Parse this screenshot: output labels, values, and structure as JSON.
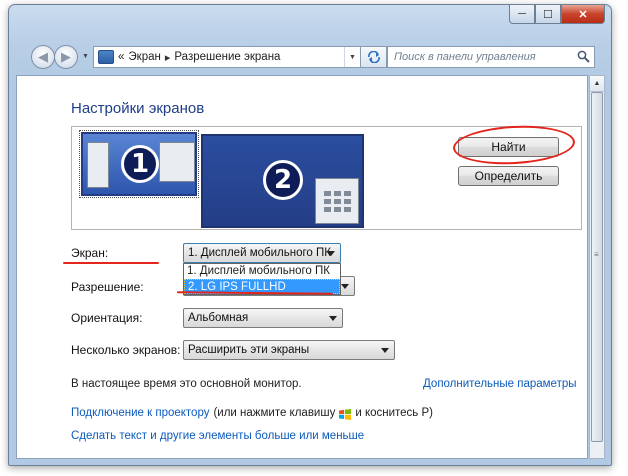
{
  "window": {
    "caption_min": "─",
    "caption_max": "☐",
    "caption_close": "✕"
  },
  "nav": {
    "back_glyph": "◀",
    "forward_glyph": "▶",
    "address_prefix": "«",
    "breadcrumb": [
      "Экран",
      "Разрешение экрана"
    ],
    "breadcrumb_sep": "▸",
    "search_placeholder": "Поиск в панели управления"
  },
  "page": {
    "title": "Настройки экранов",
    "monitors": [
      {
        "number": "1",
        "selected": true
      },
      {
        "number": "2",
        "selected": false
      }
    ],
    "buttons": {
      "find": "Найти",
      "identify": "Определить"
    },
    "fields": {
      "screen_label": "Экран:",
      "screen_value": "1. Дисплей мобильного ПК",
      "screen_options": [
        "1. Дисплей мобильного ПК",
        "2. LG IPS FULLHD"
      ],
      "resolution_label": "Разрешение:",
      "orientation_label": "Ориентация:",
      "orientation_value": "Альбомная",
      "multi_label": "Несколько экранов:",
      "multi_value": "Расширить эти экраны"
    },
    "status_text": "В настоящее время это основной монитор.",
    "advanced_link": "Дополнительные параметры",
    "projector_link": "Подключение к проектору",
    "projector_hint_before": "(или нажмите клавишу",
    "projector_hint_after": "и коснитесь P)",
    "bigger_text_link": "Сделать текст и другие элементы больше или меньше"
  },
  "colors": {
    "annotation_red": "#e3251b",
    "link_blue": "#0b5bbd",
    "title_blue": "#1f3f8a",
    "selection_blue": "#3399ff"
  }
}
